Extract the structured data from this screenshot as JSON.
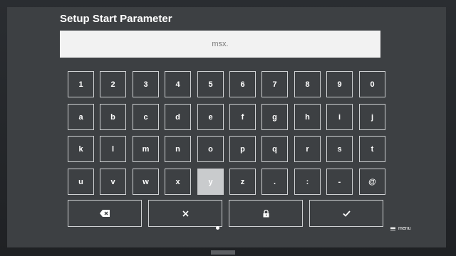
{
  "dialog": {
    "title": "Setup Start Parameter",
    "input_value": "msx."
  },
  "keyboard": {
    "rows": [
      [
        "1",
        "2",
        "3",
        "4",
        "5",
        "6",
        "7",
        "8",
        "9",
        "0"
      ],
      [
        "a",
        "b",
        "c",
        "d",
        "e",
        "f",
        "g",
        "h",
        "i",
        "j"
      ],
      [
        "k",
        "l",
        "m",
        "n",
        "o",
        "p",
        "q",
        "r",
        "s",
        "t"
      ],
      [
        "u",
        "v",
        "w",
        "x",
        "y",
        "z",
        ".",
        ":",
        "-",
        "@"
      ]
    ],
    "selected_key": "y",
    "action_icons": [
      "backspace-icon",
      "clear-icon",
      "lock-icon",
      "check-icon"
    ]
  },
  "footer": {
    "menu_label": "menu"
  },
  "colors": {
    "screen_bg": "#3d4043",
    "key_border": "#cfd1d3",
    "key_selected": "#c9cbcd",
    "input_bg": "#f2f2f2"
  }
}
